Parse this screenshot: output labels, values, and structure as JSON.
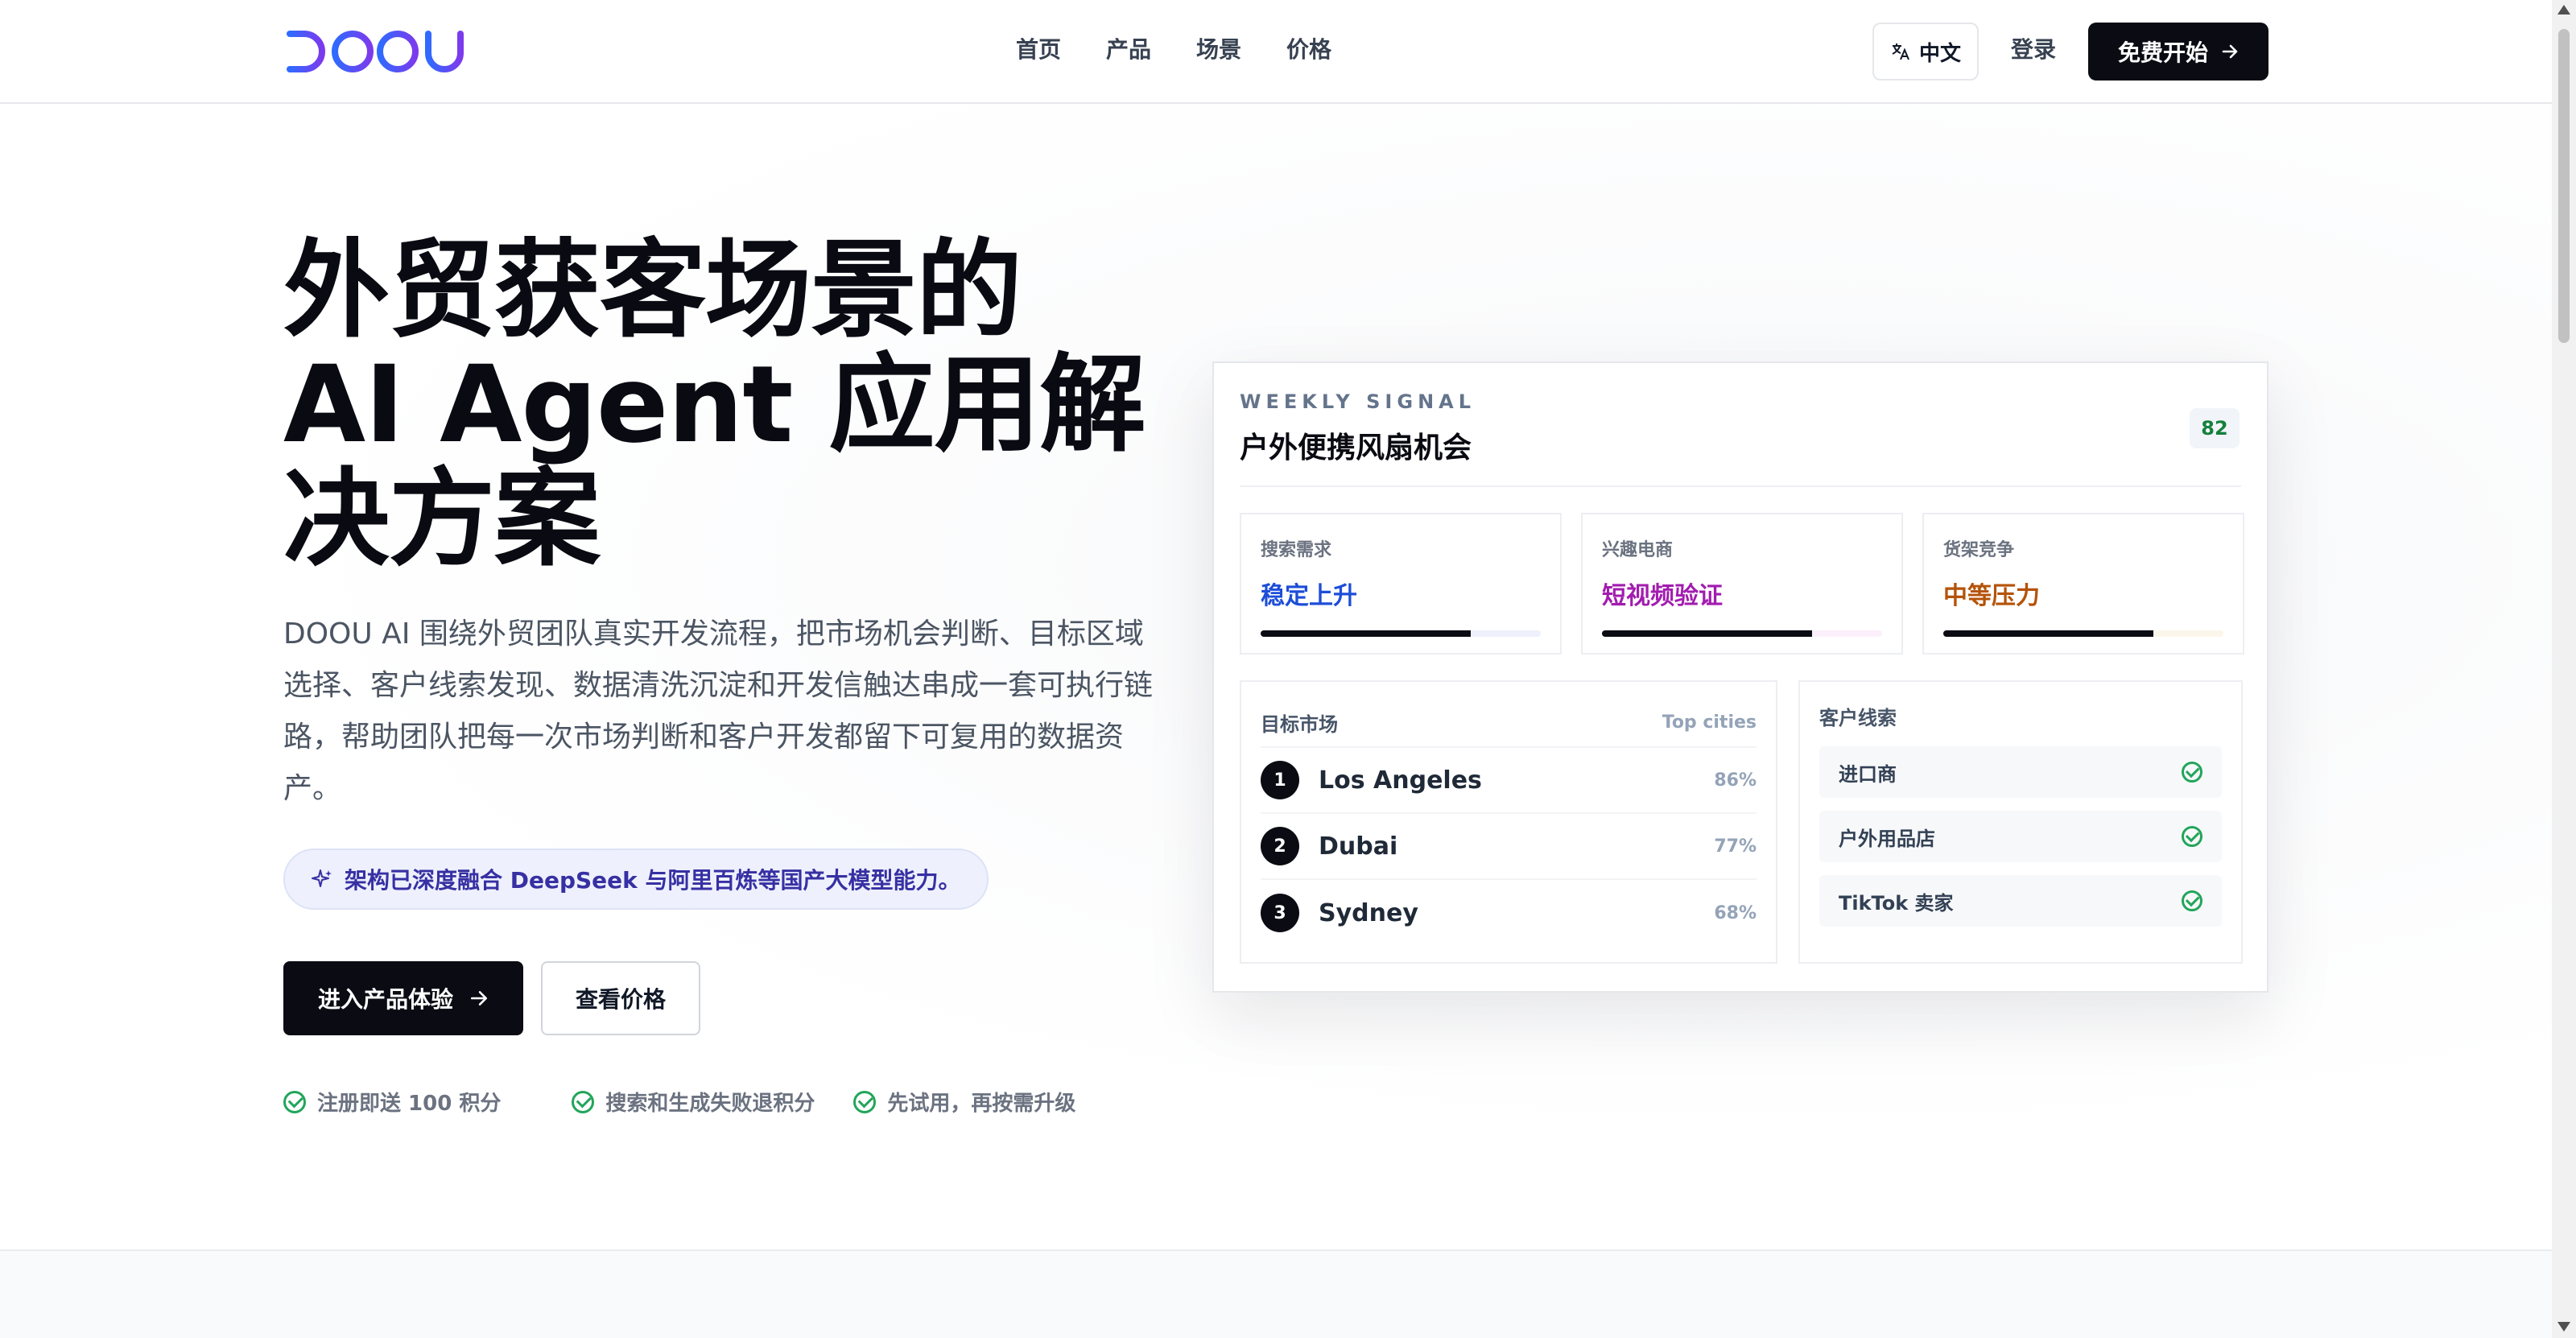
{
  "brand": {
    "logo_text": "DOOU"
  },
  "nav": {
    "items": [
      "首页",
      "产品",
      "场景",
      "价格"
    ]
  },
  "header": {
    "lang_label": "中文",
    "login_label": "登录",
    "cta_label": "免费开始"
  },
  "hero": {
    "title": "外贸获客场景的\nAI Agent 应用解\n决方案",
    "description": "DOOU AI 围绕外贸团队真实开发流程，把市场机会判断、目标区域选择、客户线索发现、数据清洗沉淀和开发信触达串成一套可执行链路，帮助团队把每一次市场判断和客户开发都留下可复用的数据资产。",
    "pill_text": "架构已深度融合 DeepSeek 与阿里百炼等国产大模型能力。",
    "primary_button": "进入产品体验",
    "secondary_button": "查看价格",
    "perks": [
      "注册即送 100 积分",
      "搜索和生成失败退积分",
      "先试用，再按需升级"
    ]
  },
  "card": {
    "kicker": "WEEKLY SIGNAL",
    "title": "户外便携风扇机会",
    "score": "82",
    "metrics": [
      {
        "label": "搜索需求",
        "value": "稳定上升",
        "color": "#1d4ed8",
        "track": "#eef1fb",
        "progress": 0.75
      },
      {
        "label": "兴趣电商",
        "value": "短视频验证",
        "color": "#a21caf",
        "track": "#fbf0fb",
        "progress": 0.75
      },
      {
        "label": "货架竞争",
        "value": "中等压力",
        "color": "#b45309",
        "track": "#fbf6ea",
        "progress": 0.75
      }
    ],
    "markets": {
      "title": "目标市场",
      "aux": "Top cities",
      "rows": [
        {
          "rank": "1",
          "city": "Los Angeles",
          "pct": "86%"
        },
        {
          "rank": "2",
          "city": "Dubai",
          "pct": "77%"
        },
        {
          "rank": "3",
          "city": "Sydney",
          "pct": "68%"
        }
      ]
    },
    "leads": {
      "title": "客户线索",
      "items": [
        "进口商",
        "户外用品店",
        "TikTok 卖家"
      ]
    }
  },
  "colors": {
    "dark": "#0b0b14",
    "accent_check": "#22a55a",
    "logo_start": "#2f6bff",
    "logo_end": "#7c3aed"
  }
}
